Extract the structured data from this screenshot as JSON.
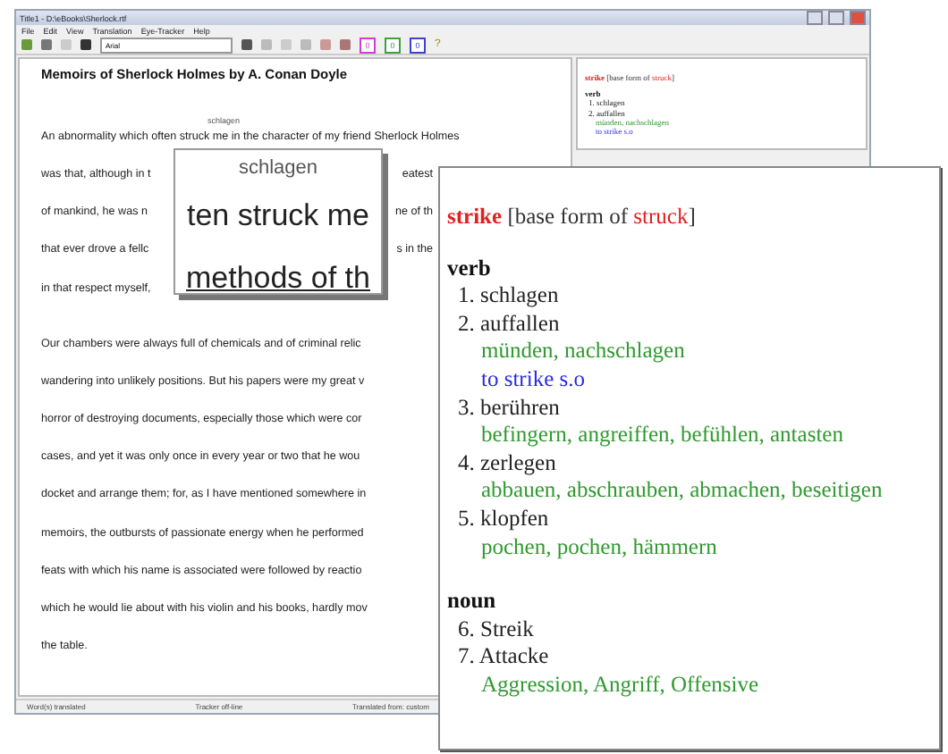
{
  "window": {
    "title": "Title1 - D:\\eBooks\\Sherlock.rtf"
  },
  "menu": [
    "File",
    "Edit",
    "View",
    "Translation",
    "Eye-Tracker",
    "Help"
  ],
  "toolbar": {
    "font_field": "Arial",
    "badges": [
      "0",
      "0",
      "0"
    ],
    "help": "?"
  },
  "document": {
    "title": "Memoirs of Sherlock Holmes by A. Conan Doyle",
    "annotation": "schlagen",
    "paragraphs": [
      [
        [
          "An abnormality which often struck me in the character of my friend Sherlock Holmes"
        ],
        [
          "was that, although in t",
          "eatest"
        ],
        [
          "of mankind, he was n",
          "ne of th"
        ],
        [
          "that ever drove a fellc",
          "s in the"
        ],
        [
          "in that respect myself,"
        ]
      ],
      [
        [
          "Our chambers were always full of chemicals and of criminal relic"
        ],
        [
          "wandering into unlikely positions. But his papers were my great v"
        ],
        [
          "horror of destroying documents, especially those which were cor"
        ],
        [
          "cases, and yet it was only once in every year or two that he wou"
        ],
        [
          "docket and arrange them; for, as I have mentioned somewhere in"
        ],
        [
          "memoirs, the outbursts of passionate energy when he performed"
        ],
        [
          "feats with which his name is associated were followed by reactio"
        ],
        [
          "which he would lie about with his violin and his books, hardly mov"
        ],
        [
          "the table."
        ]
      ]
    ]
  },
  "magnifier": {
    "gloss": "schlagen",
    "line": "ten struck me",
    "next_line": "methods of th"
  },
  "mini_panel": {
    "headword": "strike",
    "before": "[base form of ",
    "base": "struck",
    "after": "]",
    "pos": "verb",
    "senses": [
      {
        "number": "1.",
        "word": "schlagen"
      },
      {
        "number": "2.",
        "word": "auffallen",
        "lines": [
          {
            "kind": "synonyms",
            "text": "münden, nachschlagen"
          },
          {
            "kind": "example",
            "text": "to strike s.o"
          }
        ]
      }
    ]
  },
  "popup": {
    "headword": "strike",
    "before": "[base form of ",
    "base": "struck",
    "after": "]",
    "groups": [
      {
        "pos": "verb",
        "senses": [
          {
            "number": "1.",
            "word": "schlagen"
          },
          {
            "number": "2.",
            "word": "auffallen",
            "lines": [
              {
                "kind": "synonyms",
                "text": "münden,  nachschlagen"
              },
              {
                "kind": "example",
                "text": "to strike s.o"
              }
            ]
          },
          {
            "number": "3.",
            "word": "berühren",
            "lines": [
              {
                "kind": "synonyms",
                "text": "befingern,  angreiffen,  befühlen,  antasten"
              }
            ]
          },
          {
            "number": "4.",
            "word": "zerlegen",
            "lines": [
              {
                "kind": "synonyms",
                "text": "abbauen,   abschrauben,  abmachen,  beseitigen"
              }
            ]
          },
          {
            "number": "5.",
            "word": "klopfen",
            "lines": [
              {
                "kind": "synonyms",
                "text": "pochen,  pochen,  hämmern"
              }
            ]
          }
        ]
      },
      {
        "pos": "noun",
        "senses": [
          {
            "number": "6.",
            "word": "Streik"
          },
          {
            "number": "7.",
            "word": "Attacke",
            "lines": [
              {
                "kind": "synonyms",
                "text": "Aggression,  Angriff,  Offensive"
              }
            ]
          }
        ]
      }
    ]
  },
  "status_bar": [
    "Word(s) translated",
    "Tracker off-line",
    "Translated from: custom"
  ]
}
